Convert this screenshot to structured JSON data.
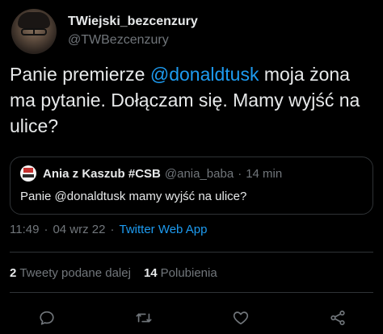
{
  "author": {
    "display_name": "TWiejski_bezcenzury",
    "handle": "@TWBezcenzury"
  },
  "tweet": {
    "text_before": "Panie premierze ",
    "mention": "@donaldtusk",
    "text_after": " moja żona ma pytanie. Dołączam się. Mamy wyjść na ulice?"
  },
  "quoted_tweet": {
    "name": "Ania z Kaszub #CSB",
    "handle": "@ania_baba",
    "separator": "·",
    "time": "14 min",
    "text": "Panie @donaldtusk mamy wyjść na ulice?"
  },
  "meta": {
    "time": "11:49",
    "separator": "·",
    "date": "04 wrz 22",
    "source": "Twitter Web App"
  },
  "stats": {
    "retweets_count": "2",
    "retweets_label": "Tweety podane dalej",
    "likes_count": "14",
    "likes_label": "Polubienia"
  },
  "actions": [
    "reply-icon",
    "retweet-icon",
    "like-icon",
    "share-icon"
  ],
  "colors": {
    "background": "#000000",
    "text": "#e7e9ea",
    "secondary": "#71767b",
    "link": "#1d9bf0",
    "border": "#2f3336"
  }
}
